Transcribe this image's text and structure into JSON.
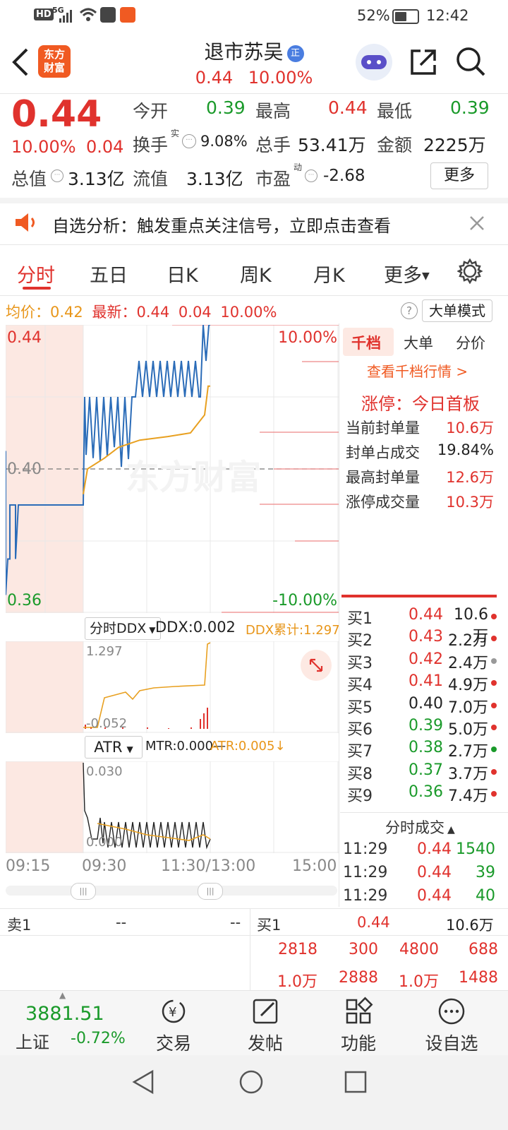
{
  "status_bar": {
    "left_icons": [
      "HD",
      "5G"
    ],
    "battery": "52%",
    "time": "12:42"
  },
  "header": {
    "back": "back-icon",
    "logo_text": "东方\n财富",
    "stock_name": "退市苏吴",
    "badge": "正",
    "price": "0.44",
    "change_pct": "10.00%"
  },
  "quote": {
    "price": "0.44",
    "pct": "10.00%",
    "change": "0.04",
    "open_label": "今开",
    "open": "0.39",
    "high_label": "最高",
    "high": "0.44",
    "low_label": "最低",
    "low": "0.39",
    "turnover_label": "换手",
    "turnover_sup": "实",
    "turnover": "9.08%",
    "volume_label": "总手",
    "volume": "53.41万",
    "amount_label": "金额",
    "amount": "2225万",
    "mktcap_label": "总值",
    "mktcap": "3.13亿",
    "float_label": "流值",
    "float": "3.13亿",
    "pe_label": "市盈",
    "pe_sup": "动",
    "pe": "-2.68",
    "more_button": "更多"
  },
  "alert": {
    "text": "自选分析：触发重点关注信号，立即点击查看"
  },
  "tabs": [
    "分时",
    "五日",
    "日K",
    "周K",
    "月K",
    "更多"
  ],
  "chart_info": {
    "avg_label": "均价：",
    "avg": "0.42",
    "latest_label": "最新：",
    "latest": "0.44",
    "change": "0.04",
    "pct": "10.00%",
    "mode_button": "大单模式"
  },
  "chart_data": {
    "type": "line",
    "price_ylim": [
      0.36,
      0.44
    ],
    "price_labels": {
      "top": "0.44",
      "mid": "0.40",
      "bottom": "0.36"
    },
    "pct_labels": {
      "top": "10.00%",
      "bottom": "-10.00%"
    },
    "x_ticks": [
      "09:15",
      "09:30",
      "11:30/13:00",
      "15:00"
    ],
    "watermark": "东方财富",
    "ddx": {
      "selector": "分时DDX",
      "value_label": "DDX:0.002",
      "cum_label": "DDX累计:1.297",
      "top": "1.297",
      "bottom": "-0.052"
    },
    "atr": {
      "selector": "ATR",
      "mtr_label": "MTR:0.000—",
      "atr_label": "ATR:0.005↓",
      "top": "0.030",
      "bottom": "0.000"
    }
  },
  "side_panel": {
    "tabs": [
      "千档",
      "大单",
      "分价"
    ],
    "link": "查看千档行情 >",
    "limit_title": "涨停：今日首板",
    "rows": [
      {
        "label": "当前封单量",
        "value": "10.6万"
      },
      {
        "label": "封单占成交",
        "value": "19.84%"
      },
      {
        "label": "最高封单量",
        "value": "12.6万"
      },
      {
        "label": "涨停成交量",
        "value": "10.3万"
      }
    ]
  },
  "order_book": [
    {
      "label": "买1",
      "price": "0.44",
      "vol": "10.6万",
      "color": "#e0322d"
    },
    {
      "label": "买2",
      "price": "0.43",
      "vol": "2.2万",
      "color": "#e0322d"
    },
    {
      "label": "买3",
      "price": "0.42",
      "vol": "2.4万",
      "color": "#999999"
    },
    {
      "label": "买4",
      "price": "0.41",
      "vol": "4.9万",
      "color": "#e0322d"
    },
    {
      "label": "买5",
      "price": "0.40",
      "vol": "7.0万",
      "color": "#e0322d"
    },
    {
      "label": "买6",
      "price": "0.39",
      "vol": "5.0万",
      "color": "#e0322d"
    },
    {
      "label": "买7",
      "price": "0.38",
      "vol": "2.7万",
      "color": "#1a9a2a"
    },
    {
      "label": "买8",
      "price": "0.37",
      "vol": "3.7万",
      "color": "#e0322d"
    },
    {
      "label": "买9",
      "price": "0.36",
      "vol": "7.4万",
      "color": "#e0322d"
    }
  ],
  "ticks_title": "分时成交",
  "ticks": [
    {
      "time": "11:29",
      "price": "0.44",
      "vol": "1540"
    },
    {
      "time": "11:29",
      "price": "0.44",
      "vol": "39"
    },
    {
      "time": "11:29",
      "price": "0.44",
      "vol": "40"
    }
  ],
  "bottom_book": {
    "sell_label": "卖1",
    "sell_price": "--",
    "sell_vol": "--",
    "buy_label": "买1",
    "buy_price": "0.44",
    "buy_vol": "10.6万",
    "queue_row1": [
      "2818",
      "300",
      "4800",
      "688"
    ],
    "queue_row2": [
      "1.0万",
      "2888",
      "1.0万",
      "1488"
    ]
  },
  "footer": {
    "index_value": "3881.51",
    "index_name": "上证",
    "index_pct": "-0.72%",
    "buttons": [
      "交易",
      "发帖",
      "功能",
      "设自选"
    ]
  }
}
